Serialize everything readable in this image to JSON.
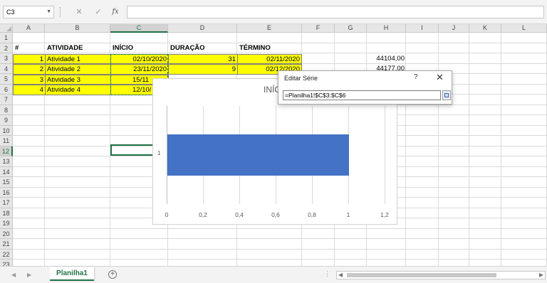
{
  "formula_bar": {
    "name_box": "C3",
    "cancel_icon": "✕",
    "enter_icon": "✓",
    "fx_label": "fx",
    "formula": ""
  },
  "columns": [
    "A",
    "B",
    "C",
    "D",
    "E",
    "F",
    "G",
    "H",
    "I",
    "J",
    "K",
    "L"
  ],
  "rows": [
    "1",
    "2",
    "3",
    "4",
    "5",
    "6",
    "7",
    "8",
    "9",
    "10",
    "11",
    "12",
    "13",
    "14",
    "15",
    "16",
    "17",
    "18",
    "19",
    "20",
    "21",
    "22",
    "23"
  ],
  "table": {
    "headers": {
      "id": "#",
      "atividade": "ATIVIDADE",
      "inicio": "INÍCIO",
      "duracao": "DURAÇÃO",
      "termino": "TÉRMINO"
    },
    "rows": [
      {
        "id": "1",
        "atividade": "Atividade 1",
        "inicio": "02/10/2020",
        "duracao": "31",
        "termino": "02/11/2020"
      },
      {
        "id": "2",
        "atividade": "Atividade 2",
        "inicio": "23/11/2020",
        "duracao": "9",
        "termino": "02/12/2020"
      },
      {
        "id": "3",
        "atividade": "Atividade 3",
        "inicio": "15/11",
        "duracao": "",
        "termino": ""
      },
      {
        "id": "4",
        "atividade": "Atividade 4",
        "inicio": "12/10/",
        "duracao": "",
        "termino": ""
      }
    ],
    "h_values": [
      "44104,00",
      "44177,00"
    ]
  },
  "chart_data": {
    "type": "bar",
    "orientation": "horizontal",
    "title": "INÍC",
    "categories": [
      "1"
    ],
    "series": [
      {
        "values": [
          1
        ],
        "color": "#4472c4"
      }
    ],
    "xlim": [
      0,
      1.2
    ],
    "xticks": [
      "0",
      "0,2",
      "0,4",
      "0,6",
      "0,8",
      "1",
      "1,2"
    ],
    "grid": true
  },
  "dialog": {
    "title": "Editar Série",
    "help": "?",
    "close": "✕",
    "value": "=Planilha1!$C$3:$C$6"
  },
  "sheet_tabs": {
    "active": "Planilha1",
    "add": "+",
    "dots": "⋮"
  },
  "colors": {
    "accent": "#217346",
    "highlight": "#ffff00",
    "bar": "#4472c4"
  }
}
